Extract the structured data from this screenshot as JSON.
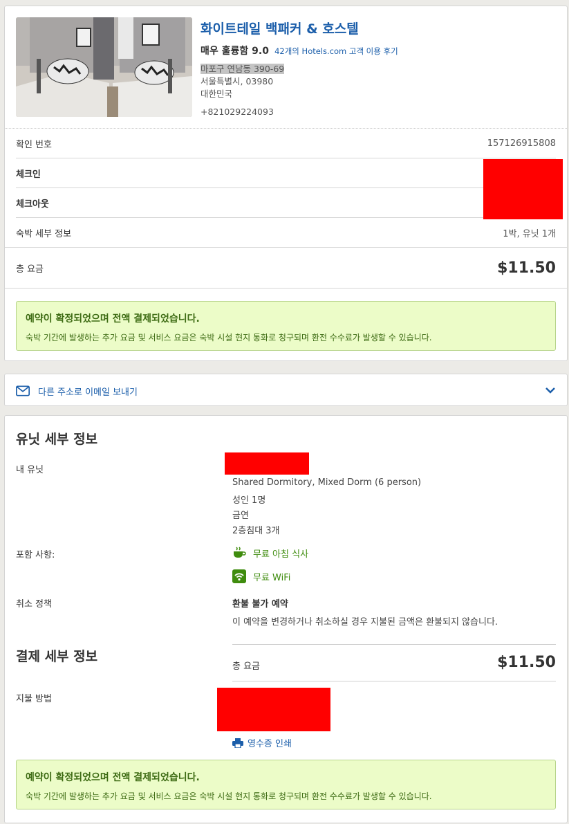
{
  "hotel": {
    "name": "화이트테일 백패커 & 호스텔",
    "rating_text": "매우 훌륭함 9.0",
    "reviews_link": "42개의 Hotels.com 고객 이용 후기",
    "address_line1": "마포구 연남동 390-69",
    "address_line2": "서울특별시, 03980",
    "address_line3": "대한민국",
    "phone": "+821029224093"
  },
  "booking": {
    "confirmation_label": "확인 번호",
    "confirmation_value": "157126915808",
    "checkin_label": "체크인",
    "checkout_label": "체크아웃",
    "stay_label": "숙박 세부 정보",
    "stay_value": "1박, 유닛 1개",
    "total_label": "총 요금",
    "total_value": "$11.50"
  },
  "notice": {
    "title": "예약이 확정되었으며 전액 결제되었습니다.",
    "text": "숙박 기간에 발생하는 추가 요금 및 서비스 요금은 숙박 시설 현지 통화로 청구되며 환전 수수료가 발생할 수 있습니다."
  },
  "email": {
    "label": "다른 주소로 이메일 보내기"
  },
  "unit": {
    "section_title": "유닛 세부 정보",
    "my_unit_label": "내 유닛",
    "room_type": "Shared Dormitory, Mixed Dorm (6 person)",
    "guests": "성인 1명",
    "smoking": "금연",
    "beds": "2층침대 3개",
    "includes_label": "포함 사항:",
    "amenity_breakfast": "무료 아침 식사",
    "amenity_wifi": "무료 WiFi",
    "cancel_label": "취소 정책",
    "cancel_title": "환불 불가 예약",
    "cancel_text": "이 예약을 변경하거나 취소하실 경우 지불된 금액은 환불되지 않습니다."
  },
  "payment": {
    "section_title": "결제 세부 정보",
    "total_label": "총 요금",
    "total_value": "$11.50",
    "method_label": "지불 방법",
    "print_receipt": "영수증 인쇄"
  },
  "colors": {
    "link": "#1b5eaa",
    "notice_bg": "#ecfcc8",
    "notice_text": "#3c6a12",
    "amenity": "#3f8c0e",
    "redaction": "#ff0000"
  }
}
